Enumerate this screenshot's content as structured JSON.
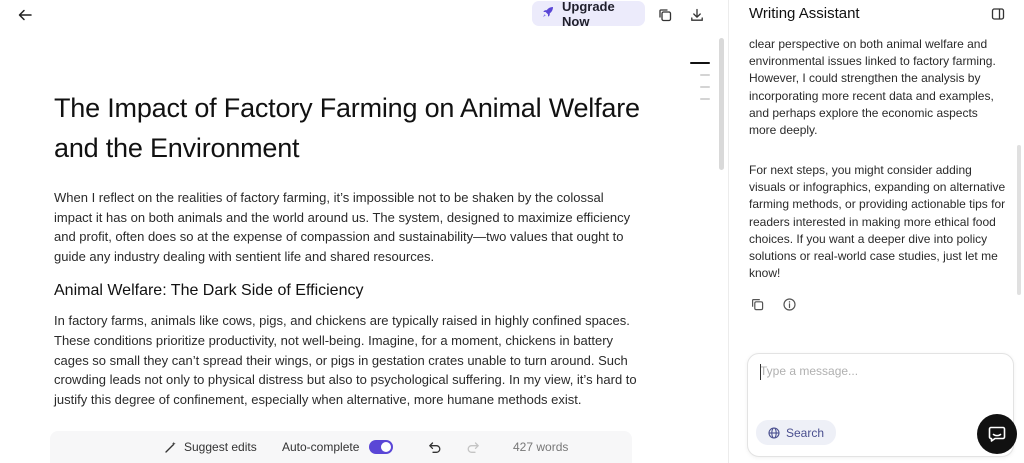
{
  "topbar": {
    "upgrade_label": "Upgrade Now",
    "icons": [
      "back-arrow-icon",
      "rocket-icon",
      "copy-icon",
      "download-icon"
    ]
  },
  "document": {
    "title": "The Impact of Factory Farming on Animal Welfare and the Environment",
    "intro": "When I reflect on the realities of factory farming, it’s impossible not to be shaken by the colossal impact it has on both animals and the world around us. The system, designed to maximize efficiency and profit, often does so at the expense of compassion and sustainability—two values that ought to guide any industry dealing with sentient life and shared resources.",
    "section_heading": "Animal Welfare: The Dark Side of Efficiency",
    "section_body": "In factory farms, animals like cows, pigs, and chickens are typically raised in highly confined spaces. These conditions prioritize productivity, not well-being. Imagine, for a moment, chickens in battery cages so small they can’t spread their wings, or pigs in gestation crates unable to turn around. Such crowding leads not only to physical distress but also to psychological suffering. In my view, it’s hard to justify this degree of confinement, especially when alternative, more humane methods exist."
  },
  "bottom_toolbar": {
    "suggest_label": "Suggest edits",
    "autocomplete_label": "Auto-complete",
    "autocomplete_on": true,
    "word_count": "427 words"
  },
  "assistant": {
    "title": "Writing Assistant",
    "message_1": "clear perspective on both animal welfare and environmental issues linked to factory farming. However, I could strengthen the analysis by incorporating more recent data and examples, and perhaps explore the economic aspects more deeply.",
    "message_2": "For next steps, you might consider adding visuals or infographics, expanding on alternative farming methods, or providing actionable tips for readers interested in making more ethical food choices. If you want a deeper dive into policy solutions or real-world case studies, just let me know!",
    "input_placeholder": "Type a message...",
    "search_label": "Search"
  },
  "colors": {
    "accent": "#5a46d6",
    "upgrade_bg": "#ecebfb",
    "fab": "#111111"
  }
}
